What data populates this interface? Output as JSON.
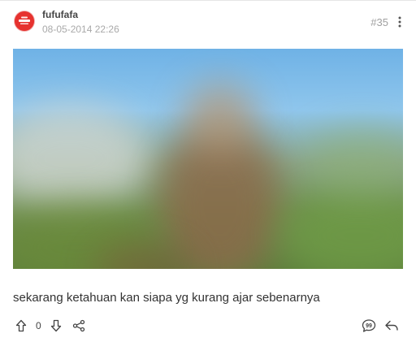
{
  "post": {
    "username": "fufufafa",
    "timestamp": "08-05-2014 22:26",
    "number": "#35",
    "caption": "sekarang ketahuan kan siapa yg kurang ajar sebenarnya",
    "vote_count": "0"
  },
  "icons": {
    "more": "vertical-dots-icon",
    "upvote": "arrow-up-icon",
    "downvote": "arrow-down-icon",
    "share": "share-icon",
    "quote": "quote-icon",
    "reply": "reply-icon"
  },
  "colors": {
    "avatar": "#e6322f",
    "text": "#333333",
    "muted": "#a9a9a9"
  }
}
